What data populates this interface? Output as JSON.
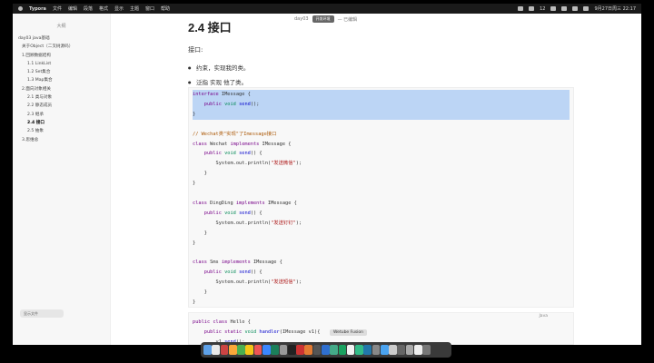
{
  "menubar": {
    "app_name": "Typora",
    "items": [
      "文件",
      "编辑",
      "段落",
      "格式",
      "显示",
      "主题",
      "窗口",
      "帮助"
    ],
    "status_text": "12",
    "clock": "9月27日周三 22:17"
  },
  "titlebar": {
    "doc_name": "day03",
    "tooltip": "开发环境",
    "suffix": "— 已编辑"
  },
  "sidebar": {
    "title": "大纲",
    "toc": [
      {
        "label": "day03 java基础",
        "level": 0
      },
      {
        "label": "关于Object（二叉树源码）",
        "level": 1
      },
      {
        "label": "1.回顾数据结构",
        "level": 1
      },
      {
        "label": "1.1 LinkList",
        "level": 2
      },
      {
        "label": "1.2 Set集合",
        "level": 2
      },
      {
        "label": "1.3 Map集合",
        "level": 2
      },
      {
        "label": "2.面向对象相关",
        "level": 1
      },
      {
        "label": "2.1 类与对象",
        "level": 2
      },
      {
        "label": "2.2 静态成员",
        "level": 2
      },
      {
        "label": "2.3 继承",
        "level": 2
      },
      {
        "label": "2.4 接口",
        "level": 2,
        "active": true
      },
      {
        "label": "2.5 抽象",
        "level": 2
      },
      {
        "label": "3.思维总",
        "level": 1
      }
    ],
    "toggle_label": "显示文件"
  },
  "content": {
    "heading": "2.4 接口",
    "intro": "接口:",
    "bullets": [
      "约束，实现我的类。",
      "泛指 实现 他了类。"
    ]
  },
  "code_block_1": {
    "lines": [
      {
        "text": "interface IMessage {",
        "hl": true
      },
      {
        "text": "    public void send();",
        "hl": true
      },
      {
        "text": "}",
        "hl": true
      },
      {
        "text": ""
      },
      {
        "text": "// Wechat类\"实现\"了Imessage接口"
      },
      {
        "text": "class Wechat implements IMessage {"
      },
      {
        "text": "    public void send() {"
      },
      {
        "text": "        System.out.println(\"发送微信\");"
      },
      {
        "text": "    }"
      },
      {
        "text": "}"
      },
      {
        "text": ""
      },
      {
        "text": "class DingDing implements IMessage {"
      },
      {
        "text": "    public void send() {"
      },
      {
        "text": "        System.out.println(\"发送钉钉\");"
      },
      {
        "text": "    }"
      },
      {
        "text": "}"
      },
      {
        "text": ""
      },
      {
        "text": "class Sms implements IMessage {"
      },
      {
        "text": "    public void send() {"
      },
      {
        "text": "        System.out.println(\"发送短信\");"
      },
      {
        "text": "    }"
      },
      {
        "text": "}"
      }
    ]
  },
  "code_block_2": {
    "language": "Java",
    "lines": [
      {
        "text": "public class Hello {"
      },
      {
        "text": "    public static void handler(IMessage v1){"
      },
      {
        "text": "        v1.send();"
      }
    ]
  },
  "dock": {
    "tooltip": "Wetube Fusion",
    "app_colors": [
      "#5ea1e8",
      "#e9e9e9",
      "#c44",
      "#fba73a",
      "#4caf50",
      "#f5c518",
      "#e55",
      "#3a86ff",
      "#1b7f5a",
      "#999",
      "#222",
      "#c33",
      "#e37b33",
      "#555",
      "#2f6fd0",
      "#4a8",
      "#1aa260",
      "#f2f2f2",
      "#3b8",
      "#27a",
      "#888",
      "#4aa3f0",
      "#ccc",
      "#666",
      "#aaa",
      "#eee",
      "#777"
    ]
  }
}
